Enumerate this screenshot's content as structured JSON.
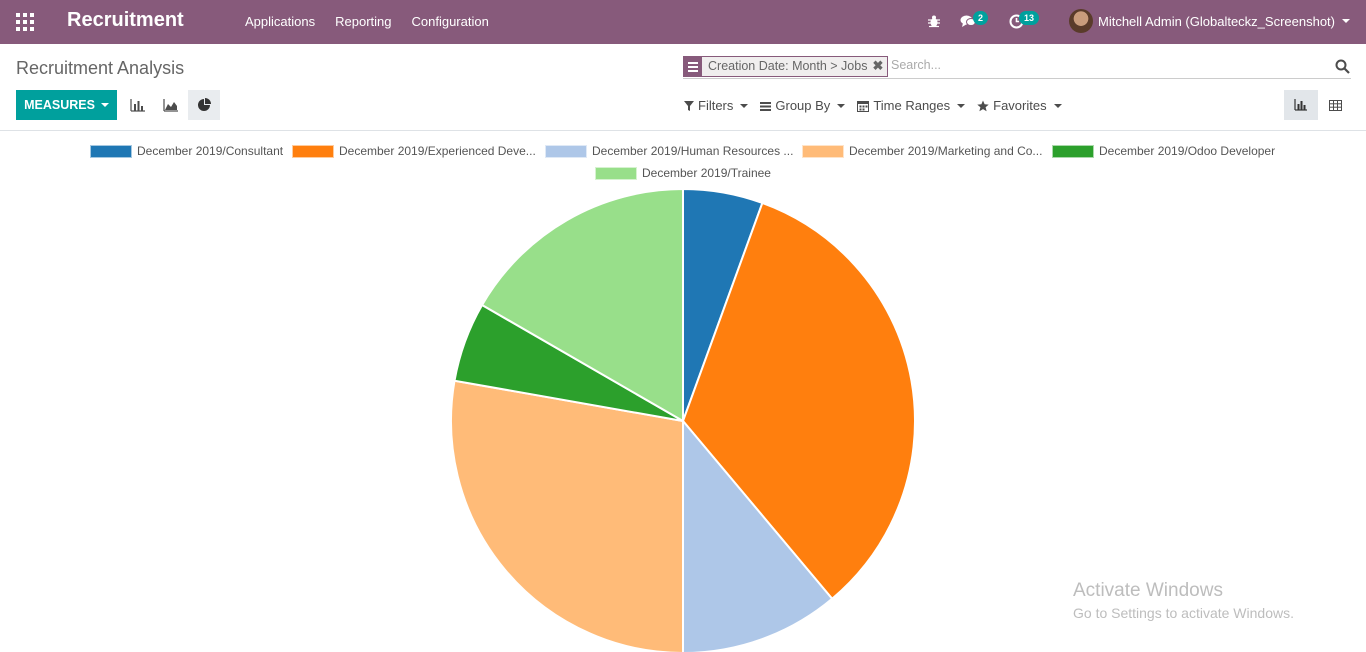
{
  "navbar": {
    "brand": "Recruitment",
    "menu": [
      "Applications",
      "Reporting",
      "Configuration"
    ],
    "messages_badge": "2",
    "activities_badge": "13",
    "user": "Mitchell Admin (Globalteckz_Screenshot)",
    "accent": "#875a7b"
  },
  "control_panel": {
    "title": "Recruitment Analysis",
    "facet": "Creation Date: Month > Jobs",
    "facet_remove": "✖",
    "search_placeholder": "Search...",
    "measures_label": "MEASURES",
    "filters": [
      "Filters",
      "Group By",
      "Time Ranges",
      "Favorites"
    ],
    "primary_color": "#00a09d"
  },
  "chart_data": {
    "type": "pie",
    "series": [
      {
        "name": "December 2019/Consultant",
        "value": 1,
        "color": "#1f77b4"
      },
      {
        "name": "December 2019/Experienced Deve...",
        "value": 6,
        "color": "#ff7f0e"
      },
      {
        "name": "December 2019/Human Resources ...",
        "value": 2,
        "color": "#aec7e8"
      },
      {
        "name": "December 2019/Marketing and Co...",
        "value": 5,
        "color": "#ffbb78"
      },
      {
        "name": "December 2019/Odoo Developer",
        "value": 1,
        "color": "#2ca02c"
      },
      {
        "name": "December 2019/Trainee",
        "value": 3,
        "color": "#98df8a"
      }
    ],
    "legend": "top"
  },
  "watermark": {
    "title": "Activate Windows",
    "subtitle": "Go to Settings to activate Windows."
  }
}
